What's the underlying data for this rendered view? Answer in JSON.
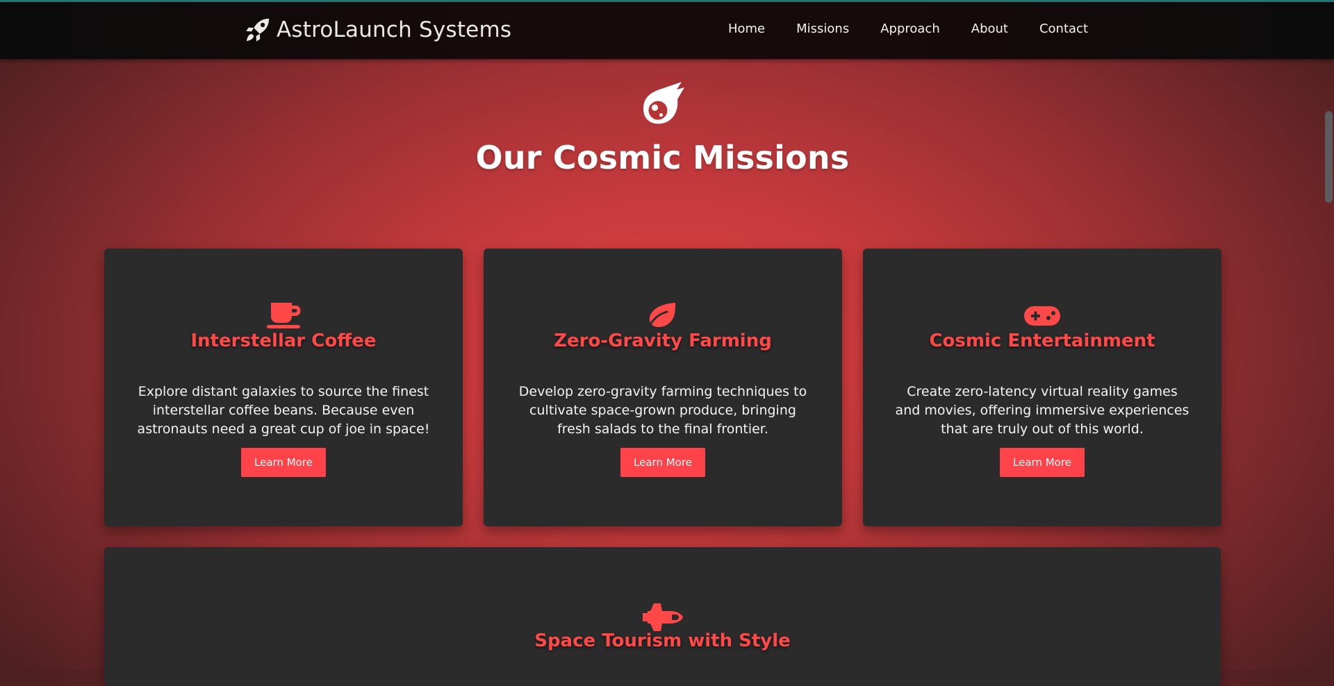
{
  "brand": {
    "name": "AstroLaunch Systems",
    "icon": "rocket-icon"
  },
  "nav": {
    "items": [
      {
        "label": "Home"
      },
      {
        "label": "Missions"
      },
      {
        "label": "Approach"
      },
      {
        "label": "About"
      },
      {
        "label": "Contact"
      }
    ]
  },
  "hero": {
    "icon": "meteor-icon",
    "title": "Our Cosmic Missions"
  },
  "missions": [
    {
      "icon": "mug-icon",
      "title": "Interstellar Coffee",
      "description": "Explore distant galaxies to source the finest interstellar coffee beans. Because even astronauts need a great cup of joe in space!",
      "button": "Learn More"
    },
    {
      "icon": "leaf-icon",
      "title": "Zero-Gravity Farming",
      "description": "Develop zero-gravity farming techniques to cultivate space-grown produce, bringing fresh salads to the final frontier.",
      "button": "Learn More"
    },
    {
      "icon": "gamepad-icon",
      "title": "Cosmic Entertainment",
      "description": "Create zero-latency virtual reality games and movies, offering immersive experiences that are truly out of this world.",
      "button": "Learn More"
    },
    {
      "icon": "space-shuttle-icon",
      "title": "Space Tourism with Style"
    }
  ],
  "colors": {
    "accent": "#ff4349",
    "card_title": "#ff4848",
    "card_background": "#2b2b2b",
    "navbar_background": "#0e0b0b",
    "page_glow": "#e24040"
  }
}
